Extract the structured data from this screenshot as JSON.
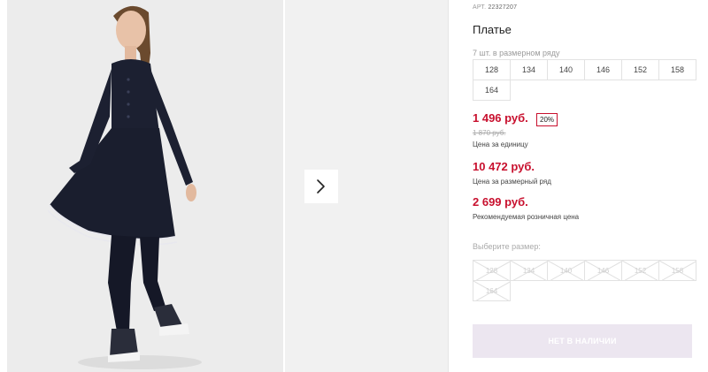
{
  "product": {
    "sku_label": "АРТ.",
    "sku_value": "22327207",
    "title": "Платье",
    "row_count": "7 шт. в размерном ряду",
    "row_sizes": [
      "128",
      "134",
      "140",
      "146",
      "152",
      "158",
      "164"
    ],
    "unit_price": "1 496 руб.",
    "discount": "20%",
    "old_price": "1 870 руб.",
    "unit_price_caption": "Цена за единицу",
    "row_price": "10 472 руб.",
    "row_price_caption": "Цена за размерный ряд",
    "retail_price": "2 699 руб.",
    "retail_price_caption": "Рекомендуемая розничная цена"
  },
  "size_select": {
    "label": "Выберите размер:",
    "sizes": [
      "128",
      "134",
      "140",
      "146",
      "152",
      "158",
      "164"
    ]
  },
  "buy_button": {
    "label": "НЕТ В НАЛИЧИИ"
  },
  "gallery": {
    "next_icon": "chevron-right-icon"
  },
  "colors": {
    "price": "#c8102e",
    "button_disabled": "#ece6f0"
  }
}
